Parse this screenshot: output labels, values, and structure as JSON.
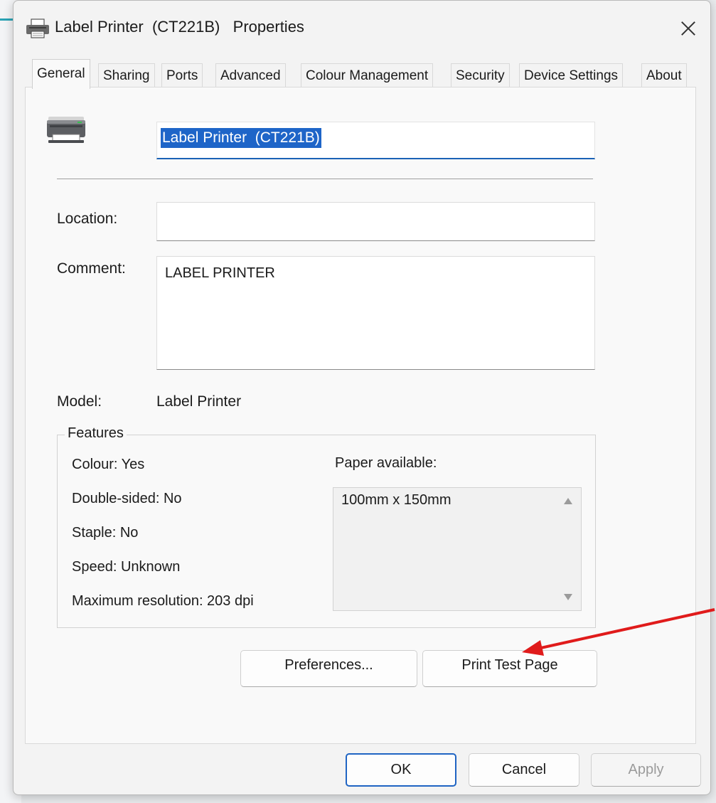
{
  "window": {
    "title": "Label Printer  (CT221B)   Properties",
    "close_icon": "close-icon"
  },
  "tabs": [
    {
      "label": "General",
      "active": true
    },
    {
      "label": "Sharing",
      "active": false
    },
    {
      "label": "Ports",
      "active": false
    },
    {
      "label": "Advanced",
      "active": false
    },
    {
      "label": "Colour Management",
      "active": false
    },
    {
      "label": "Security",
      "active": false
    },
    {
      "label": "Device Settings",
      "active": false
    },
    {
      "label": "About",
      "active": false
    }
  ],
  "general": {
    "printer_icon": "printer-icon",
    "printer_name": "Label Printer  (CT221B)",
    "location_label": "Location:",
    "location_value": "",
    "comment_label": "Comment:",
    "comment_value": "LABEL PRINTER",
    "model_label": "Model:",
    "model_value": "Label Printer"
  },
  "features": {
    "legend": "Features",
    "colour": "Colour: Yes",
    "double_sided": "Double-sided: No",
    "staple": "Staple: No",
    "speed": "Speed: Unknown",
    "max_resolution": "Maximum resolution: 203 dpi",
    "paper_label": "Paper available:",
    "paper_items": [
      "100mm x 150mm"
    ]
  },
  "buttons": {
    "preferences": "Preferences...",
    "print_test_page": "Print Test Page",
    "ok": "OK",
    "cancel": "Cancel",
    "apply": "Apply"
  },
  "colors": {
    "accent": "#1f64c3",
    "annotation_arrow": "#e01b1b"
  }
}
